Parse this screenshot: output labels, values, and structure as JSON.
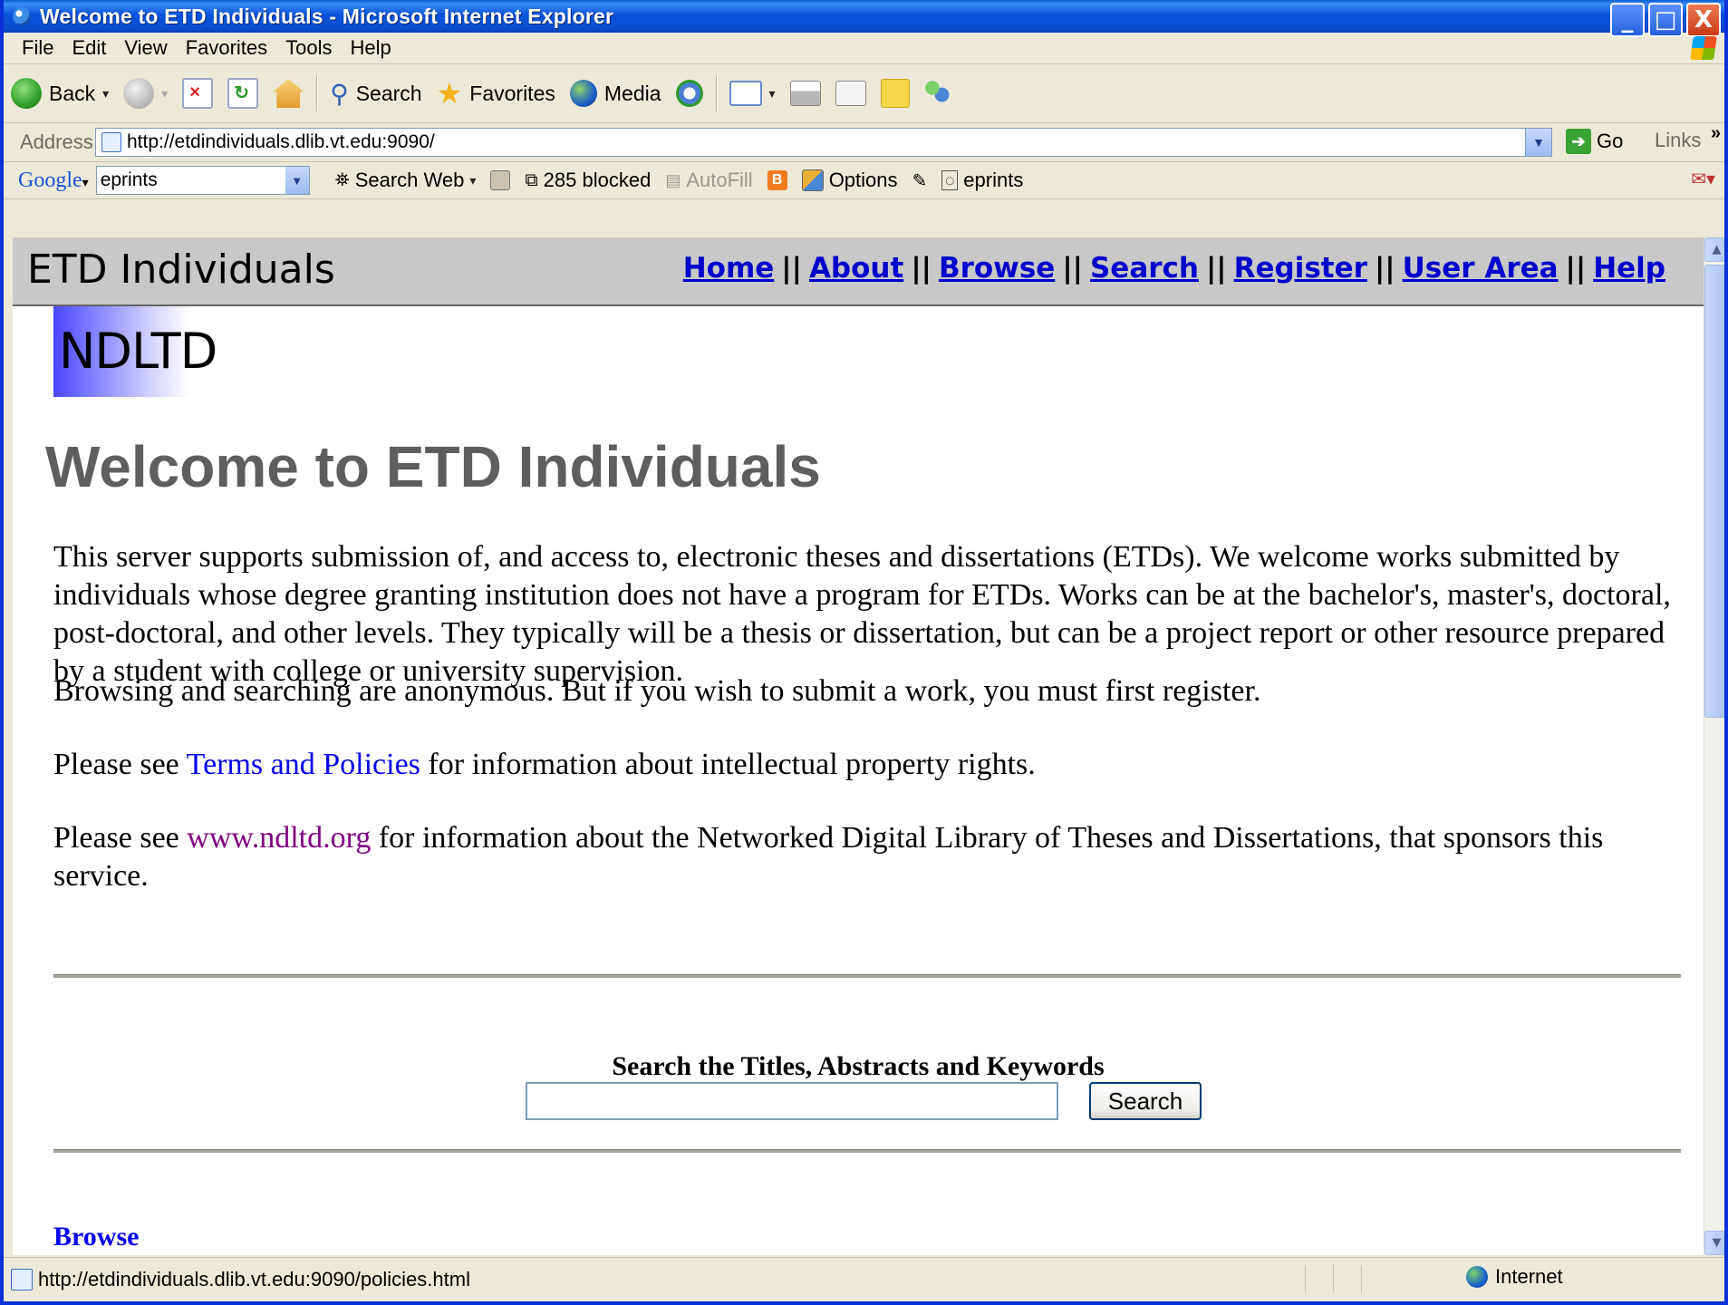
{
  "window": {
    "title": "Welcome to ETD Individuals - Microsoft Internet Explorer",
    "controls": [
      "_",
      "□",
      "X"
    ]
  },
  "menu": [
    "File",
    "Edit",
    "View",
    "Favorites",
    "Tools",
    "Help"
  ],
  "toolbar": {
    "back": "Back",
    "search": "Search",
    "favorites": "Favorites",
    "media": "Media"
  },
  "address": {
    "label": "Address",
    "url": "http://etdindividuals.dlib.vt.edu:9090/",
    "go": "Go",
    "links": "Links",
    "chevron": "»"
  },
  "google_bar": {
    "logo": "Google",
    "query": "eprints",
    "search_web": "Search Web",
    "blocked": "285 blocked",
    "autofill": "AutoFill",
    "options": "Options",
    "highlight_term": "eprints"
  },
  "site": {
    "title": "ETD Individuals",
    "nav": [
      "Home",
      "About",
      "Browse",
      "Search",
      "Register",
      "User Area",
      "Help"
    ],
    "nav_separator": "||",
    "logo_text": "NDLTD"
  },
  "main": {
    "heading": "Welcome to ETD Individuals",
    "para1": "This server supports submission of, and access to, electronic theses and dissertations (ETDs). We welcome works submitted by individuals whose degree granting institution does not have a program for ETDs. Works can be at the bachelor's, master's, doctoral, post-doctoral, and other levels. They typically will be a thesis or dissertation, but can be a project report or other resource prepared by a student with college or university supervision.",
    "para2": "Browsing and searching are anonymous. But if you wish to submit a work, you must first register.",
    "para3_pre": "Please see ",
    "para3_link": "Terms and Policies",
    "para3_post": " for information about intellectual property rights.",
    "para4_pre": "Please see ",
    "para4_link": "www.ndltd.org",
    "para4_post": " for information about the Networked Digital Library of Theses and Dissertations, that sponsors this service.",
    "search_heading": "Search the Titles, Abstracts and Keywords",
    "search_value": "",
    "search_button": "Search",
    "browse_link": "Browse"
  },
  "status": {
    "text": "http://etdindividuals.dlib.vt.edu:9090/policies.html",
    "zone": "Internet"
  }
}
